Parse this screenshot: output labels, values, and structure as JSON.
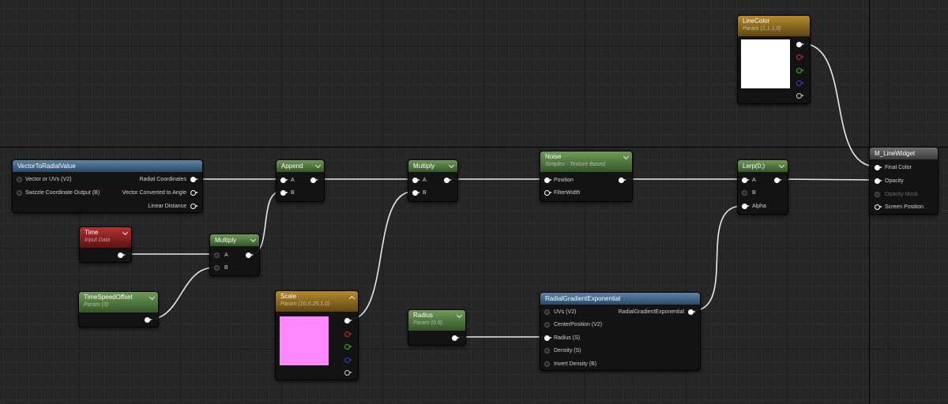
{
  "nodes": {
    "vector_to_radial": {
      "title": "VectorToRadialValue",
      "inputs": [
        "Vector or UVs (V2)",
        "Swizzle Coordinate Output (B)"
      ],
      "outputs": [
        "Radial Coordinates",
        "Vector Converted to Angle",
        "Linear Distance"
      ]
    },
    "time": {
      "title": "Time",
      "subtitle": "Input Data"
    },
    "time_speed_offset": {
      "title": "TimeSpeedOffset",
      "subtitle": "Param (3)"
    },
    "multiply_1": {
      "title": "Multiply",
      "inputs": [
        "A",
        "B"
      ]
    },
    "append": {
      "title": "Append",
      "inputs": [
        "A",
        "B"
      ]
    },
    "multiply_2": {
      "title": "Multiply",
      "inputs": [
        "A",
        "B"
      ]
    },
    "scale": {
      "title": "Scale",
      "subtitle": "Param (10,0.25,1,0)",
      "color": "#ff88ff"
    },
    "noise": {
      "title": "Noise",
      "subtitle": "Simplex - Texture Based",
      "inputs": [
        "Position",
        "FilterWidth"
      ]
    },
    "radius": {
      "title": "Radius",
      "subtitle": "Param (0.5)"
    },
    "radial_gradient": {
      "title": "RadialGradientExponential",
      "inputs": [
        "UVs (V2)",
        "CenterPosition (V2)",
        "Radius (S)",
        "Density (S)",
        "Invert Density (B)"
      ],
      "output": "RadialGradientExponential"
    },
    "lerp": {
      "title": "Lerp(0,)",
      "inputs": [
        "A",
        "B",
        "Alpha"
      ]
    },
    "line_color": {
      "title": "LineColor",
      "subtitle": "Param (1,1,1,0)",
      "color": "#ffffff"
    },
    "m_line_widget": {
      "title": "M_LineWidget",
      "inputs": [
        "Final Color",
        "Opacity",
        "Opacity Mask",
        "Screen Position"
      ]
    }
  },
  "colors": {
    "header_blue": "#4a6f92",
    "header_green": "#4f7a3c",
    "header_red": "#8e2020",
    "header_gold": "#8f6b1d",
    "wire": "#e8e8e8"
  }
}
